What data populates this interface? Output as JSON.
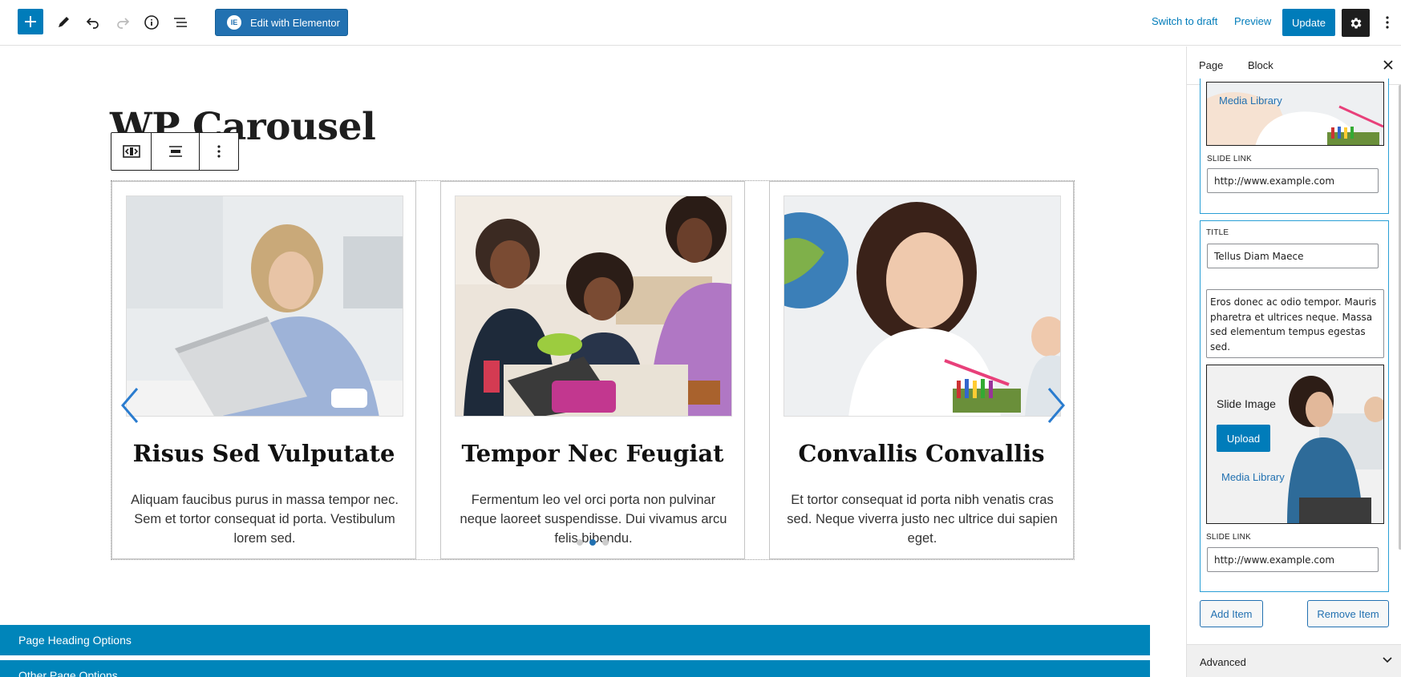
{
  "toolbar": {
    "add_block_label": "Add block",
    "elementor_label": "Edit with Elementor",
    "elementor_badge": "IE",
    "switch_to_draft": "Switch to draft",
    "preview": "Preview",
    "update": "Update"
  },
  "page": {
    "title": "WP Carousel"
  },
  "carousel": {
    "slides": [
      {
        "title": "Risus Sed Vulputate",
        "text": "Aliquam faucibus purus in massa tempor nec. Sem et tortor consequat id porta. Vestibulum lorem sed.",
        "image": "woman-laptop-photo"
      },
      {
        "title": "Tempor Nec Feugiat",
        "text": "Fermentum leo vel orci porta non pulvinar neque laoreet suspendisse. Dui vivamus arcu felis bibendu.",
        "image": "kids-lunch-photo"
      },
      {
        "title": "Convallis Convallis",
        "text": "Et tortor consequat id porta nibh venatis cras sed. Neque viverra justo nec ultrice dui sapien eget.",
        "image": "teacher-smiling-photo"
      }
    ],
    "dots": 3,
    "active_dot": 1
  },
  "meta_boxes": {
    "page_heading_options": "Page Heading Options",
    "other_page_options": "Other Page Options"
  },
  "sidebar": {
    "tab_page": "Page",
    "tab_block": "Block",
    "item1": {
      "media_library": "Media Library",
      "slide_link_label": "SLIDE LINK",
      "slide_link_value": "http://www.example.com"
    },
    "item2": {
      "title_label": "TITLE",
      "title_value": "Tellus Diam Maece",
      "description_value": "Eros donec ac odio tempor. Mauris pharetra et ultrices neque. Massa sed elementum tempus egestas sed.",
      "slide_image_label": "Slide Image",
      "upload_label": "Upload",
      "media_library": "Media Library",
      "slide_link_label": "SLIDE LINK",
      "slide_link_value": "http://www.example.com"
    },
    "add_item": "Add Item",
    "remove_item": "Remove Item",
    "advanced": "Advanced"
  },
  "colors": {
    "wp_blue": "#007cba",
    "meta_bar_blue": "#0085ba",
    "link_blue": "#2271b1",
    "dark": "#1e1e1e"
  }
}
